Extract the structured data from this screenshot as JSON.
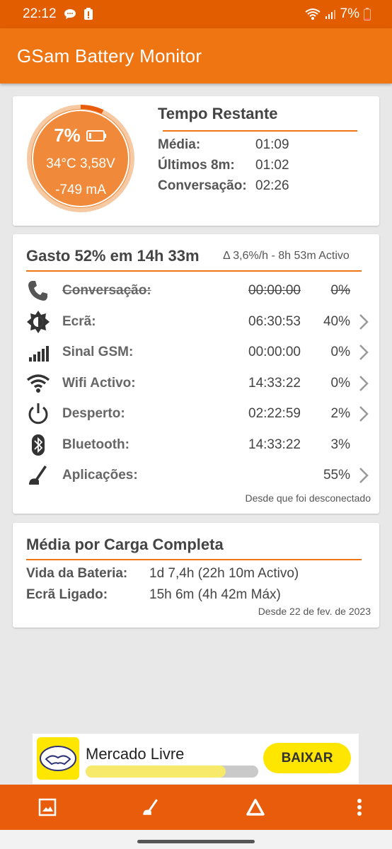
{
  "status_bar": {
    "time": "22:12",
    "battery_percent": "7%",
    "icons": [
      "chat-bubble-icon",
      "alert-icon",
      "wifi-icon",
      "signal-icon",
      "battery-low-icon"
    ]
  },
  "app_bar": {
    "title": "GSam Battery Monitor"
  },
  "colors": {
    "accent": "#ef7512",
    "status_bar": "#e25d00",
    "bottom_nav": "#e85c0c",
    "ring": "#f08a3a"
  },
  "battery_ring": {
    "percent": "7%",
    "level_fraction": 0.07,
    "temp_voltage": "34°C  3,58V",
    "current": "-749 mA"
  },
  "time_remaining": {
    "title": "Tempo Restante",
    "rows": [
      {
        "label": "Média:",
        "value": "01:09"
      },
      {
        "label": "Últimos 8m:",
        "value": "01:02"
      },
      {
        "label": "Conversação:",
        "value": "02:26"
      }
    ]
  },
  "usage": {
    "title": "Gasto 52% em 14h 33m",
    "subtitle": "Δ 3,6%/h - 8h 53m Activo",
    "rows": [
      {
        "icon": "phone-icon",
        "name": "Conversação:",
        "time": "00:00:00",
        "pct": "0%",
        "chevron": false,
        "struck": true
      },
      {
        "icon": "brightness-icon",
        "name": "Ecrã:",
        "time": "06:30:53",
        "pct": "40%",
        "chevron": true,
        "struck": false
      },
      {
        "icon": "signal-bars-icon",
        "name": "Sinal GSM:",
        "time": "00:00:00",
        "pct": "0%",
        "chevron": true,
        "struck": false
      },
      {
        "icon": "wifi-icon",
        "name": "Wifi Activo:",
        "time": "14:33:22",
        "pct": "0%",
        "chevron": true,
        "struck": false
      },
      {
        "icon": "power-icon",
        "name": "Desperto:",
        "time": "02:22:59",
        "pct": "2%",
        "chevron": true,
        "struck": false
      },
      {
        "icon": "bluetooth-icon",
        "name": "Bluetooth:",
        "time": "14:33:22",
        "pct": "3%",
        "chevron": false,
        "struck": false
      },
      {
        "icon": "apps-icon",
        "name": "Aplicações:",
        "time": "",
        "pct": "55%",
        "chevron": true,
        "struck": false
      }
    ],
    "note": "Desde que foi desconectado"
  },
  "full_charge": {
    "title": "Média por Carga Completa",
    "rows": [
      {
        "label": "Vida da Bateria:",
        "value": "1d 7,4h (22h 10m Activo)"
      },
      {
        "label": "Ecrã Ligado:",
        "value": "15h 6m (4h 42m Máx)"
      }
    ],
    "since": "Desde 22 de fev. de 2023"
  },
  "ad": {
    "name": "Mercado Livre",
    "button": "BAIXAR",
    "progress_fraction": 0.81
  },
  "bottom_nav": {
    "items": [
      "image-icon",
      "apps-icon",
      "delta-icon",
      "more-vert-icon"
    ]
  }
}
